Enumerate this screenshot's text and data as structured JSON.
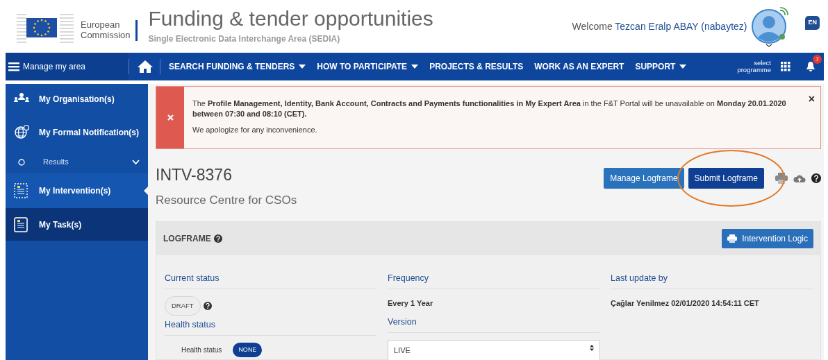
{
  "header": {
    "logo_lines": [
      "European",
      "Commission"
    ],
    "title": "Funding & tender opportunities",
    "subtitle": "Single Electronic Data Interchange Area (SEDIA)",
    "welcome": "Welcome",
    "user": "Tezcan Eralp ABAY (nabaytez)",
    "language": "EN"
  },
  "navbar": {
    "menu_label": "Manage my area",
    "items": [
      {
        "label": "SEARCH FUNDING & TENDERS",
        "dropdown": true
      },
      {
        "label": "HOW TO PARTICIPATE",
        "dropdown": true
      },
      {
        "label": "PROJECTS & RESULTS",
        "dropdown": false
      },
      {
        "label": "WORK AS AN EXPERT",
        "dropdown": false
      },
      {
        "label": "SUPPORT",
        "dropdown": true
      }
    ],
    "programme_lines": [
      "select",
      "programme"
    ],
    "notification_count": "7"
  },
  "sidebar": {
    "items": [
      {
        "label": "My Organisation(s)",
        "kind": "org",
        "selected": false
      },
      {
        "label": "My Formal Notification(s)",
        "kind": "globe",
        "selected": false
      },
      {
        "label": "Results",
        "kind": "group",
        "selected": false
      },
      {
        "label": "My Intervention(s)",
        "kind": "doc",
        "selected": true
      },
      {
        "label": "My Task(s)",
        "kind": "task",
        "selected": false
      }
    ]
  },
  "alert": {
    "close": "×",
    "message": "The **Profile Management, Identity, Bank Account, Contracts and Payments functionalities in My Expert Area** in the F&T Portal will be unavailable on **Monday 20.01.2020 between 07:30 and 08:10 (CET).**",
    "note": "We apologize for any inconvenience."
  },
  "intervention": {
    "code": "INTV-8376",
    "name": "Resource Centre for CSOs",
    "buttons": [
      {
        "label": "Manage Logframe",
        "kind": "secondary",
        "highlighted": false
      },
      {
        "label": "Submit Logframe",
        "kind": "primary",
        "highlighted": true
      }
    ]
  },
  "logframe": {
    "title": "LOGFRAME",
    "action": "Intervention Logic",
    "current_status": {
      "label": "Current status",
      "value": "DRAFT"
    },
    "health_status": {
      "label": "Health status",
      "field_label": "Health status",
      "value": "NONE"
    },
    "frequency": {
      "label": "Frequency",
      "value": "Every 1 Year"
    },
    "version": {
      "label": "Version",
      "value": "LIVE"
    },
    "last_update": {
      "label": "Last update by",
      "value": "Çağlar Yenilmez 02/01/2020 14:54:11 CET"
    }
  }
}
